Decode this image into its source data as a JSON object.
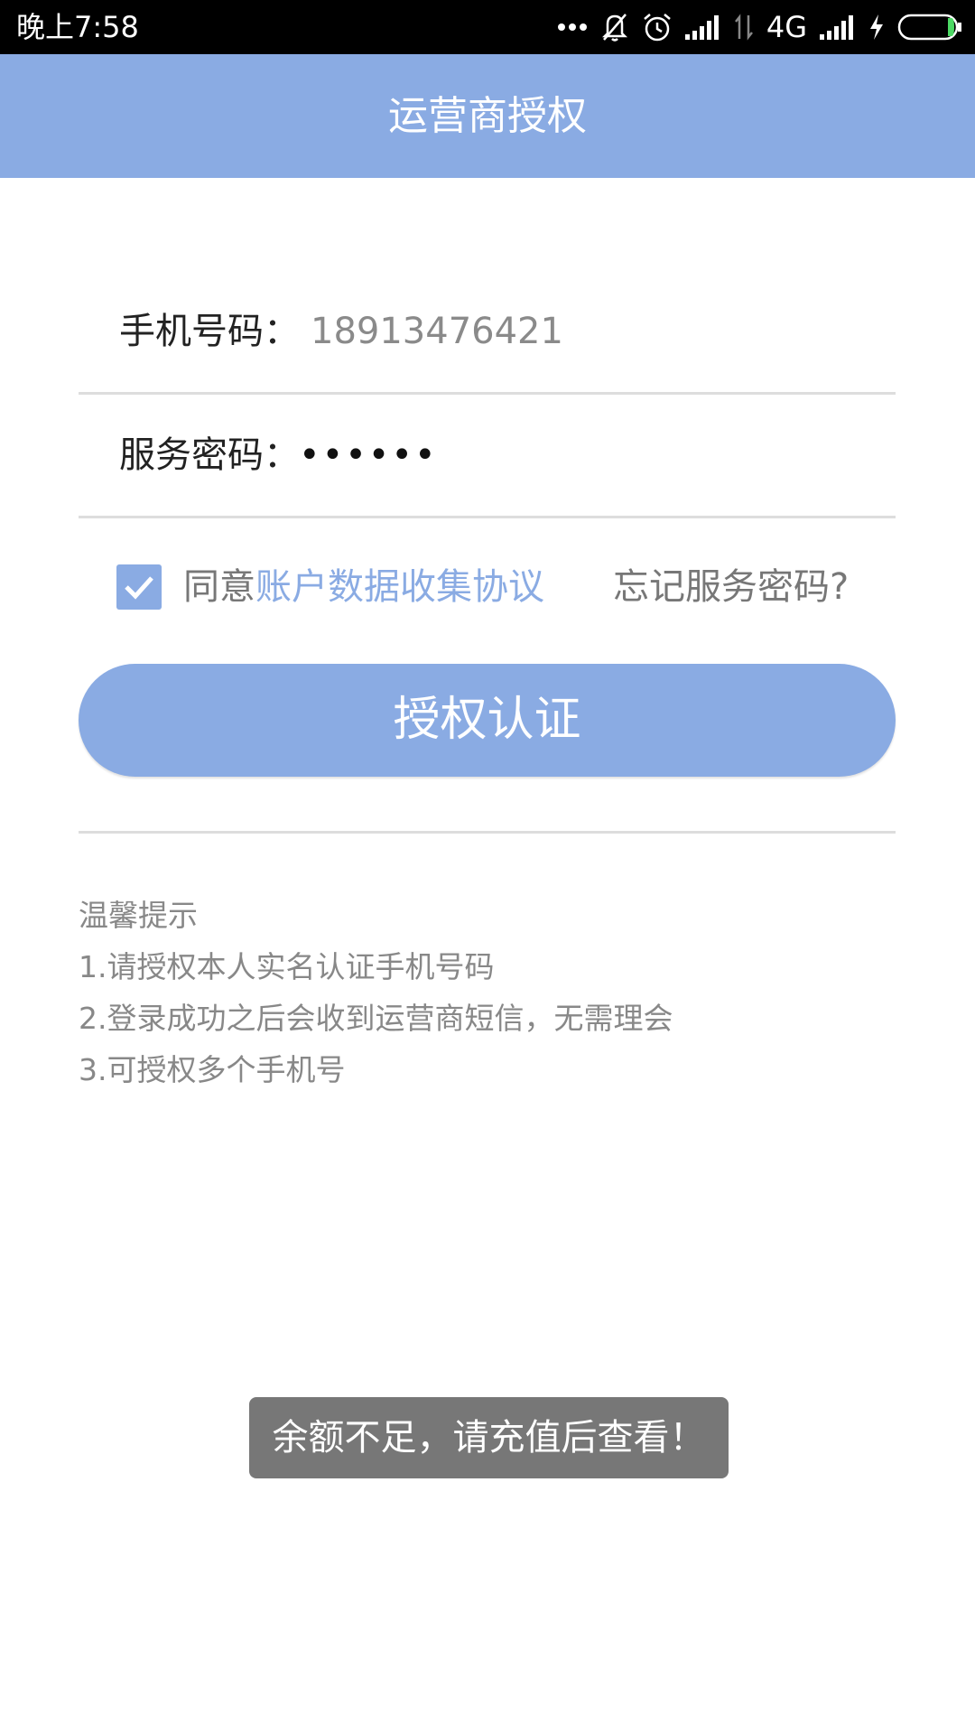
{
  "status_bar": {
    "time": "晚上7:58",
    "network": "4G",
    "icons": [
      "more-dots-icon",
      "bell-off-icon",
      "alarm-icon",
      "signal-icon",
      "data-arrows-icon",
      "signal-icon",
      "charging-icon",
      "battery-icon"
    ]
  },
  "header": {
    "title": "运营商授权"
  },
  "form": {
    "phone_label": "手机号码：",
    "phone_value": "18913476421",
    "password_label": "服务密码：",
    "password_value": "••••••"
  },
  "agreement": {
    "checked": true,
    "prefix": "同意",
    "link_text": "账户数据收集协议",
    "forgot_password": "忘记服务密码?"
  },
  "auth_button": {
    "label": "授权认证"
  },
  "tips": {
    "title": "温馨提示",
    "items": [
      "1.请授权本人实名认证手机号码",
      "2.登录成功之后会收到运营商短信，无需理会",
      "3.可授权多个手机号"
    ]
  },
  "toast": {
    "message": "余额不足，请充值后查看！"
  },
  "colors": {
    "accent": "#8aabe3",
    "toast_bg": "#777777",
    "divider": "#dddddd"
  }
}
